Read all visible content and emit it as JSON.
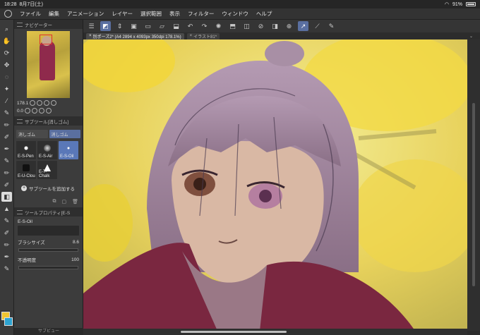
{
  "status": {
    "time": "18:28",
    "date": "8月7日(土)",
    "battery": "91%"
  },
  "menu": [
    "ファイル",
    "編集",
    "アニメーション",
    "レイヤー",
    "選択範囲",
    "表示",
    "フィルター",
    "ウィンドウ",
    "ヘルプ"
  ],
  "navigator": {
    "title": "ナビゲーター",
    "zoom": "178.1",
    "rotation": "0.0"
  },
  "subtool": {
    "title": "サブツール[消しゴム]",
    "tabs": [
      "消しゴム",
      "消しゴム"
    ],
    "brushes": [
      {
        "label": "E-S-Pen"
      },
      {
        "label": "E-S-Air"
      },
      {
        "label": "E-S-Oil"
      },
      {
        "label": "E-U-Clou"
      },
      {
        "label": "E-T-Chalk"
      }
    ],
    "add_label": "サブツールを追加する"
  },
  "tool_property": {
    "title": "ツールプロパティ[E-S",
    "brush_name": "E-S-Oil",
    "size_label": "ブラシサイズ",
    "size_value": "8.6",
    "opacity_label": "不透明度",
    "opacity_value": "100"
  },
  "canvas_tabs": [
    {
      "label": "別ポーズ2* (A4 2894 x 4093px 350dpi 178.1%)"
    },
    {
      "label": "イラスト81*"
    }
  ],
  "subview_label": "サブビュー",
  "colors": {
    "main": "#f0c531",
    "sub": "#2da3d1",
    "accent": "#5a6fa0"
  }
}
